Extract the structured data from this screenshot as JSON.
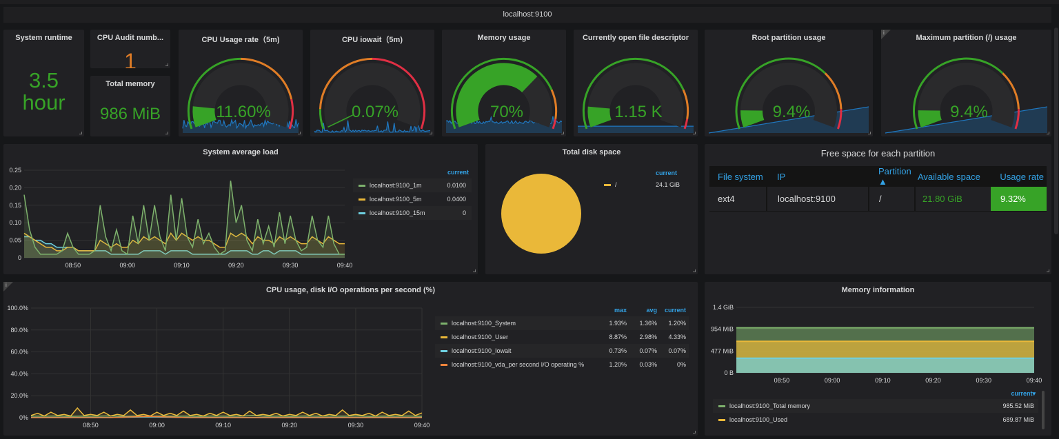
{
  "header": {
    "title": "localhost:9100"
  },
  "stats": {
    "runtime": {
      "title": "System runtime",
      "value": "3.5",
      "unit": "hour"
    },
    "cpu_audit": {
      "title": "CPU Audit numb...",
      "value": "1"
    },
    "total_memory": {
      "title": "Total memory",
      "value": "986 MiB"
    }
  },
  "gauges": [
    {
      "title": "CPU Usage rate（5m)",
      "value": "11.60%",
      "fraction": 0.116,
      "thresholds": [
        0.5,
        0.85
      ],
      "spark": "noise"
    },
    {
      "title": "CPU iowait（5m)",
      "value": "0.07%",
      "fraction": 0.0007,
      "thresholds": [
        0.1,
        0.5
      ],
      "spark": "spiky"
    },
    {
      "title": "Memory usage",
      "value": "70%",
      "fraction": 0.7,
      "thresholds": [
        0.8,
        0.95
      ],
      "spark": "flat"
    },
    {
      "title": "Currently open file descriptor",
      "value": "1.15 K",
      "fraction": 0.115,
      "thresholds": [
        0.8,
        0.95
      ],
      "spark": "line"
    },
    {
      "title": "Root partition usage",
      "value": "9.4%",
      "fraction": 0.094,
      "thresholds": [
        0.7,
        0.9
      ],
      "spark": "ramp"
    },
    {
      "title": "Maximum partition (/) usage",
      "value": "9.4%",
      "fraction": 0.094,
      "thresholds": [
        0.7,
        0.9
      ],
      "spark": "ramp"
    }
  ],
  "colors": {
    "green": "#299c46",
    "gauge_green": "#37a327",
    "orange": "#e07d26",
    "red": "#e02f44",
    "yellow": "#eab839",
    "blue": "#1f78c1",
    "cyan": "#6ed0e0",
    "lightgreen": "#7eb26d",
    "legend_header": "#33a2e5"
  },
  "load_chart": {
    "title": "System average load",
    "time_range": [
      "08:41",
      "09:40"
    ],
    "y_ticks": [
      "0",
      "0.05",
      "0.10",
      "0.15",
      "0.20",
      "0.25"
    ],
    "ylim": [
      0,
      0.25
    ],
    "x_ticks": [
      "08:50",
      "09:00",
      "09:10",
      "09:20",
      "09:30",
      "09:40"
    ],
    "legend_header": "current",
    "series": [
      {
        "name": "localhost:9100_1m",
        "current": "0.0100",
        "color": "#7eb26d",
        "values": [
          0.18,
          0.08,
          0.03,
          0.01,
          0.01,
          0.01,
          0.01,
          0.02,
          0.07,
          0.03,
          0.01,
          0.01,
          0.01,
          0.02,
          0.15,
          0.06,
          0.02,
          0.08,
          0.02,
          0.01,
          0.12,
          0.04,
          0.15,
          0.05,
          0.15,
          0.06,
          0.02,
          0.18,
          0.05,
          0.17,
          0.06,
          0.03,
          0.11,
          0.04,
          0.07,
          0.03,
          0.01,
          0.02,
          0.22,
          0.1,
          0.15,
          0.05,
          0.02,
          0.11,
          0.04,
          0.09,
          0.03,
          0.13,
          0.04,
          0.12,
          0.05,
          0.02,
          0.03,
          0.12,
          0.05,
          0.03,
          0.12,
          0.04,
          0.01,
          0.01
        ]
      },
      {
        "name": "localhost:9100_5m",
        "current": "0.0400",
        "color": "#eab839",
        "values": [
          0.07,
          0.06,
          0.05,
          0.04,
          0.03,
          0.03,
          0.02,
          0.02,
          0.03,
          0.03,
          0.02,
          0.02,
          0.02,
          0.02,
          0.05,
          0.04,
          0.03,
          0.04,
          0.03,
          0.03,
          0.05,
          0.04,
          0.06,
          0.05,
          0.06,
          0.05,
          0.04,
          0.07,
          0.05,
          0.07,
          0.06,
          0.05,
          0.06,
          0.05,
          0.05,
          0.04,
          0.03,
          0.03,
          0.07,
          0.06,
          0.07,
          0.06,
          0.04,
          0.06,
          0.05,
          0.05,
          0.04,
          0.06,
          0.05,
          0.06,
          0.05,
          0.04,
          0.04,
          0.06,
          0.05,
          0.04,
          0.06,
          0.05,
          0.04,
          0.04
        ]
      },
      {
        "name": "localhost:9100_15m",
        "current": "0",
        "color": "#6ed0e0",
        "values": [
          0.06,
          0.06,
          0.05,
          0.05,
          0.04,
          0.04,
          0.03,
          0.03,
          0.03,
          0.03,
          0.02,
          0.02,
          0.02,
          0.02,
          0.02,
          0.02,
          0.01,
          0.01,
          0.01,
          0.01,
          0.01,
          0.01,
          0.02,
          0.02,
          0.02,
          0.02,
          0.01,
          0.02,
          0.02,
          0.02,
          0.02,
          0.01,
          0.01,
          0.01,
          0.01,
          0.01,
          0.01,
          0.01,
          0.02,
          0.02,
          0.02,
          0.02,
          0.01,
          0.01,
          0.02,
          0.02,
          0.01,
          0.02,
          0.02,
          0.02,
          0.02,
          0.01,
          0.01,
          0.01,
          0.01,
          0.01,
          0.01,
          0.01,
          0.01,
          0.01
        ]
      }
    ]
  },
  "disk_chart": {
    "title": "Total disk space",
    "type": "pie",
    "legend_header": "current",
    "slices": [
      {
        "name": "/",
        "value": "24.1 GiB",
        "color": "#eab839"
      }
    ]
  },
  "partition_table": {
    "title": "Free space for each partition",
    "columns": [
      "File system",
      "IP",
      "Partition ▲",
      "Available space",
      "Usage rate"
    ],
    "rows": [
      [
        "ext4",
        "localhost:9100",
        "/",
        "21.80 GiB",
        "9.32%"
      ]
    ]
  },
  "cpu_chart": {
    "title": "CPU usage, disk I/O operations per second (%)",
    "time_range": [
      "08:41",
      "09:40"
    ],
    "y_ticks": [
      "0%",
      "20.0%",
      "40.0%",
      "60.0%",
      "80.0%",
      "100.0%"
    ],
    "ylim": [
      0,
      100
    ],
    "x_ticks": [
      "08:50",
      "09:00",
      "09:10",
      "09:20",
      "09:30",
      "09:40"
    ],
    "legend_headers": [
      "max",
      "avg",
      "current"
    ],
    "series": [
      {
        "name": "localhost:9100_System",
        "max": "1.93%",
        "avg": "1.36%",
        "current": "1.20%",
        "color": "#7eb26d",
        "values": [
          1.4,
          1.3,
          1.5,
          1.2,
          1.4,
          1.3,
          1.6,
          1.2,
          1.4,
          1.3,
          1.5,
          1.3,
          1.4,
          1.2,
          1.5,
          1.3,
          1.4,
          1.9,
          1.3,
          1.4,
          1.2,
          1.5,
          1.3,
          1.4,
          1.3,
          1.6,
          1.2,
          1.4,
          1.3,
          1.5,
          1.2
        ]
      },
      {
        "name": "localhost:9100_User",
        "max": "8.87%",
        "avg": "2.98%",
        "current": "4.33%",
        "color": "#eab839",
        "values": [
          2,
          4,
          1.5,
          5,
          2,
          3,
          1.5,
          8.8,
          2,
          3,
          2,
          5,
          1.5,
          3,
          2,
          7,
          2,
          3,
          1.5,
          5,
          2,
          4,
          2,
          6,
          2,
          3,
          1.5,
          4,
          2,
          5,
          2,
          3,
          1.5,
          6,
          2,
          3,
          2,
          4,
          1.5,
          3,
          2,
          5,
          2,
          4,
          1.5,
          3,
          2,
          7,
          2,
          3,
          2,
          4,
          1.5,
          5,
          2,
          3,
          2,
          6,
          2,
          4.3
        ]
      },
      {
        "name": "localhost:9100_Iowait",
        "max": "0.73%",
        "avg": "0.07%",
        "current": "0.07%",
        "color": "#6ed0e0",
        "values": [
          0.05,
          0.1,
          0.05,
          0.7,
          0.05,
          0.1,
          0.05,
          0.05,
          0.1,
          0.05,
          0.07
        ]
      },
      {
        "name": "localhost:9100_vda_per second I/O operating %",
        "max": "1.20%",
        "avg": "0.03%",
        "current": "0%",
        "color": "#ef843c",
        "values": [
          0,
          0,
          0,
          1.2,
          0,
          0,
          0,
          0,
          0,
          0,
          0
        ]
      }
    ]
  },
  "memory_chart": {
    "title": "Memory information",
    "time_range": [
      "08:41",
      "09:40"
    ],
    "y_ticks": [
      "0 B",
      "477 MiB",
      "954 MiB",
      "1.4 GiB"
    ],
    "ylim_mib": [
      0,
      1431
    ],
    "x_ticks": [
      "08:50",
      "09:00",
      "09:10",
      "09:20",
      "09:30",
      "09:40"
    ],
    "legend_header": "current▾",
    "series": [
      {
        "name": "localhost:9100_Total memory",
        "current": "985.52 MiB",
        "color": "#7eb26d",
        "value_mib": 985.52
      },
      {
        "name": "localhost:9100_Used",
        "current": "689.87 MiB",
        "color": "#eab839",
        "value_mib": 689.87
      },
      {
        "color": "#6ed0e0",
        "value_mib": 320
      }
    ]
  }
}
